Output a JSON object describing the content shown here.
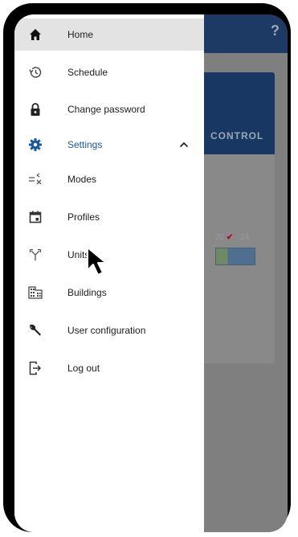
{
  "header": {
    "help_label": "?"
  },
  "background": {
    "control_label": "CONTROL",
    "scale_low": "20",
    "scale_high": "24"
  },
  "menu": {
    "items": [
      {
        "label": "Home",
        "icon": "home-icon"
      },
      {
        "label": "Schedule",
        "icon": "history-icon"
      },
      {
        "label": "Change password",
        "icon": "lock-icon"
      },
      {
        "label": "Settings",
        "icon": "gear-icon"
      },
      {
        "label": "Modes",
        "icon": "modes-icon"
      },
      {
        "label": "Profiles",
        "icon": "calendar-icon"
      },
      {
        "label": "Units",
        "icon": "split-arrows-icon"
      },
      {
        "label": "Buildings",
        "icon": "building-icon"
      },
      {
        "label": "User configuration",
        "icon": "wrench-icon"
      },
      {
        "label": "Log out",
        "icon": "logout-icon"
      }
    ],
    "selected": "Home",
    "expanded": "Settings"
  },
  "colors": {
    "accent": "#1c5aa0",
    "header": "#1c3a63",
    "selected_bg": "#e3e3e3"
  }
}
